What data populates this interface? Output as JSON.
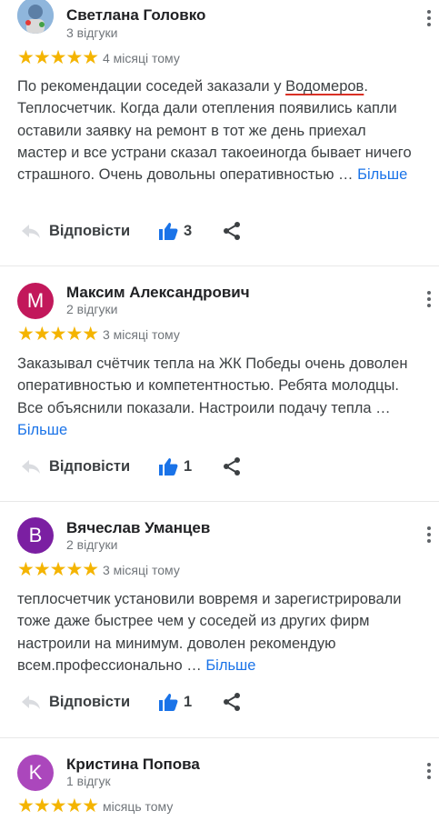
{
  "reviews": [
    {
      "author": "Светлана Головко",
      "review_count": "3 відгуки",
      "rating": 5,
      "stars": "★★★★★",
      "date": "4 місяці тому",
      "text_before": "По рекомендации соседей заказали у ",
      "text_highlight": "Водомеров",
      "text_after": ". Теплосчетчик. Когда дали отепления появились капли оставили заявку на ремонт в тот же день приехал мастер и все устрани сказал такоеиногда бывает ничего страшного. Очень довольны оперативностью … ",
      "more": "Більше",
      "reply": "Відповісти",
      "likes": "3",
      "avatar_icon": "photo-avatar"
    },
    {
      "author": "Максим Александрович",
      "review_count": "2 відгуки",
      "rating": 5,
      "stars": "★★★★★",
      "date": "3 місяці тому",
      "text": "Заказывал счётчик тепла на ЖК Победы очень доволен оперативностью и компетентностью. Ребята молодцы. Все объяснили показали. Настроили подачу тепла … ",
      "more": "Більше",
      "reply": "Відповісти",
      "likes": "1",
      "avatar_letter": "М",
      "avatar_color": "#c2185b"
    },
    {
      "author": "Вячеслав Уманцев",
      "review_count": "2 відгуки",
      "rating": 5,
      "stars": "★★★★★",
      "date": "3 місяці тому",
      "text": "теплосчетчик установили вовремя и зарегистрировали тоже даже быстрее чем у соседей из других фирм настроили на минимум. доволен рекомендую всем.профессионально … ",
      "more": "Більше",
      "reply": "Відповісти",
      "likes": "1",
      "avatar_letter": "B",
      "avatar_color": "#7b1fa2"
    },
    {
      "author": "Кристина Попова",
      "review_count": "1 відгук",
      "rating": 5,
      "stars": "★★★★★",
      "date": "місяць тому",
      "avatar_letter": "K",
      "avatar_color": "#ab47bc"
    }
  ],
  "colors": {
    "star": "#f4b400",
    "link": "#1a73e8",
    "like": "#1a73e8",
    "highlight_underline": "#d93025"
  },
  "icons": [
    "kebab-menu-icon",
    "reply-arrow-icon",
    "thumbs-up-icon",
    "share-icon"
  ]
}
